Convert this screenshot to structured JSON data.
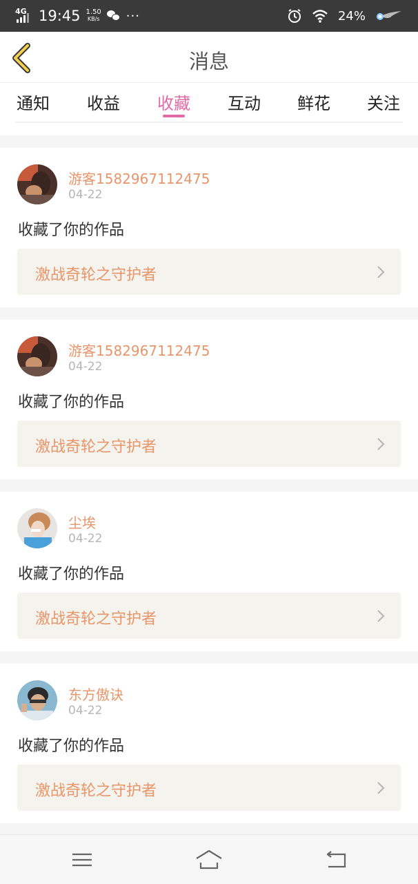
{
  "status_bar": {
    "network": "4G",
    "time": "19:45",
    "speed_value": "1.50",
    "speed_unit": "KB/s",
    "more": "···",
    "battery": "24%"
  },
  "header": {
    "title": "消息"
  },
  "tabs": [
    {
      "label": "通知"
    },
    {
      "label": "收益"
    },
    {
      "label": "收藏"
    },
    {
      "label": "互动"
    },
    {
      "label": "鲜花"
    },
    {
      "label": "关注"
    }
  ],
  "active_tab": "收藏",
  "messages": [
    {
      "user": "游客1582967112475",
      "date": "04-22",
      "action": "收藏了你的作品",
      "work": "激战奇轮之守护者"
    },
    {
      "user": "游客1582967112475",
      "date": "04-22",
      "action": "收藏了你的作品",
      "work": "激战奇轮之守护者"
    },
    {
      "user": "尘埃",
      "date": "04-22",
      "action": "收藏了你的作品",
      "work": "激战奇轮之守护者"
    },
    {
      "user": "东方傲诀",
      "date": "04-22",
      "action": "收藏了你的作品",
      "work": "激战奇轮之守护者"
    }
  ],
  "colors": {
    "accent_pink": "#e16aa7",
    "accent_orange": "#e8956a",
    "status_bar_bg": "#3a3a3a"
  }
}
